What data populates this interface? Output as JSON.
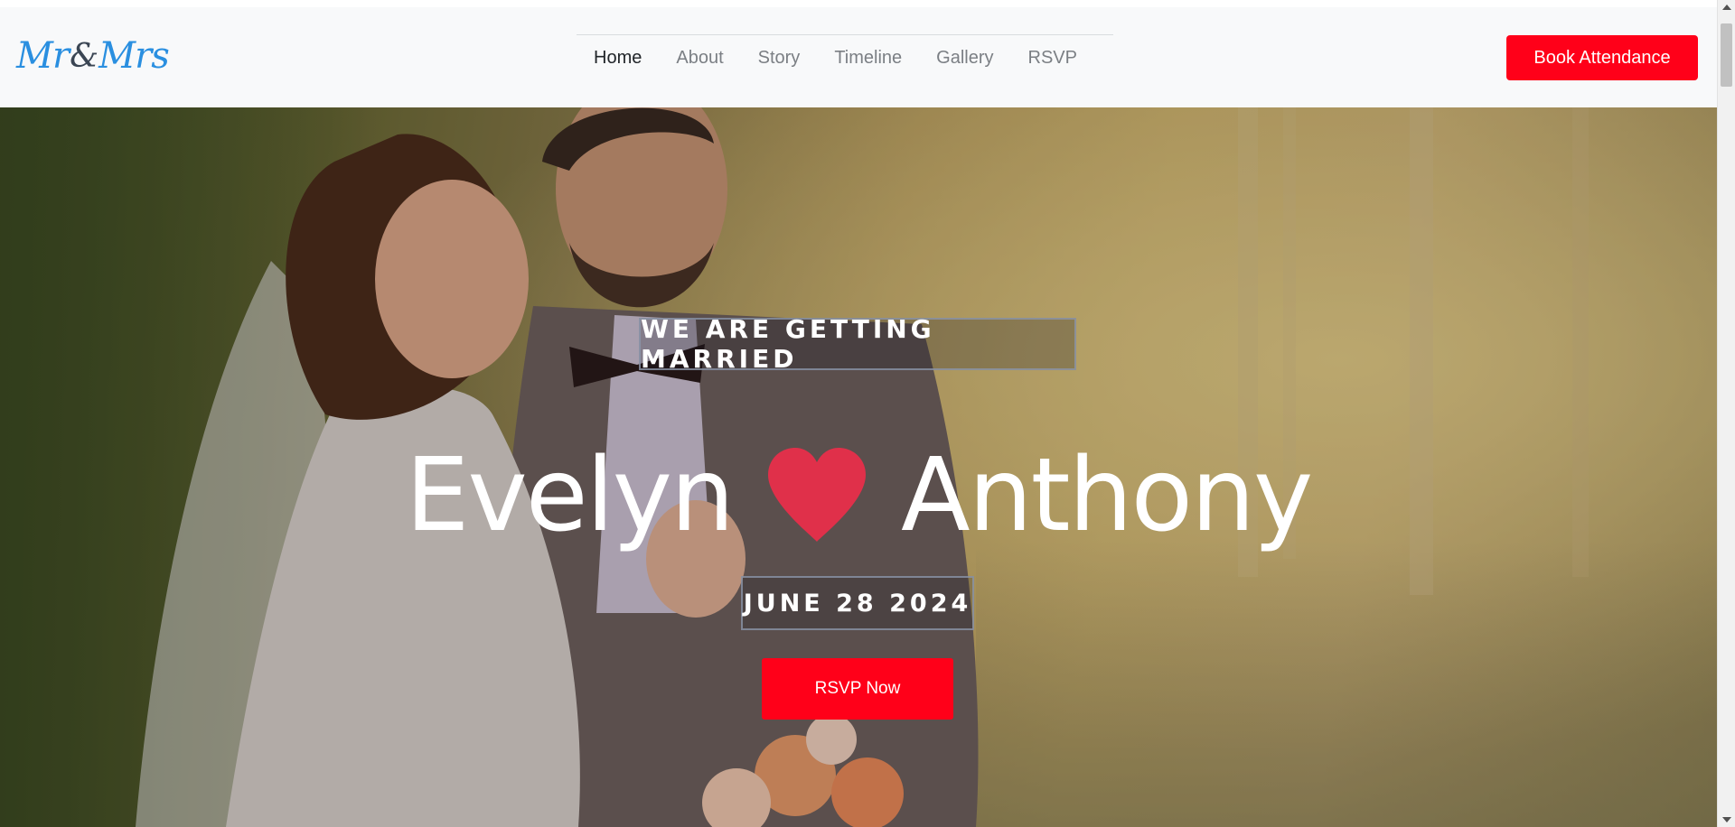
{
  "brand": {
    "logo_left": "Mr",
    "logo_amp": "&",
    "logo_right": "Mrs"
  },
  "nav": {
    "items": [
      {
        "label": "Home",
        "active": true
      },
      {
        "label": "About",
        "active": false
      },
      {
        "label": "Story",
        "active": false
      },
      {
        "label": "Timeline",
        "active": false
      },
      {
        "label": "Gallery",
        "active": false
      },
      {
        "label": "RSVP",
        "active": false
      }
    ],
    "cta_label": "Book Attendance"
  },
  "hero": {
    "tagline": "WE ARE GETTING MARRIED",
    "bride": "Evelyn",
    "groom": "Anthony",
    "date": "JUNE 28 2024",
    "cta_label": "RSVP Now",
    "heart_icon": "heart-icon"
  },
  "colors": {
    "accent": "#ff0019",
    "heart": "#e0304a",
    "logo": "#2a8fe0",
    "navbar_bg": "#f8f9fa"
  }
}
